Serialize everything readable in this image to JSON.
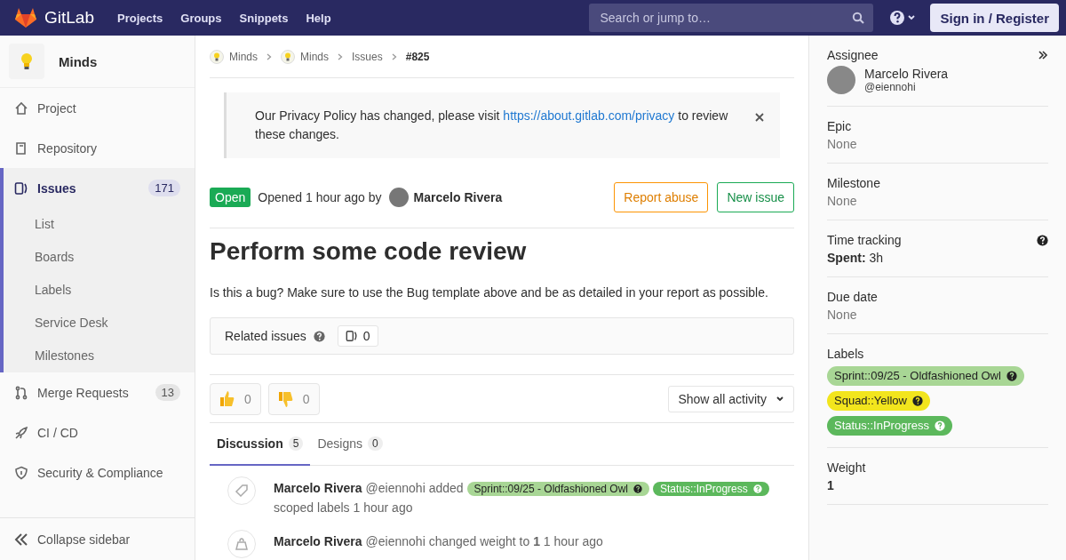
{
  "topbar": {
    "brand": "GitLab",
    "nav": [
      "Projects",
      "Groups",
      "Snippets",
      "Help"
    ],
    "search": {
      "placeholder": "Search or jump to…"
    },
    "sign_in": "Sign in / Register"
  },
  "sidebar": {
    "project": "Minds",
    "items": [
      {
        "label": "Project",
        "kind": "home",
        "selected": false
      },
      {
        "label": "Repository",
        "kind": "book",
        "selected": false
      },
      {
        "label": "Issues",
        "kind": "issues",
        "count": "171",
        "selected": true,
        "children": [
          {
            "label": "List"
          },
          {
            "label": "Boards"
          },
          {
            "label": "Labels"
          },
          {
            "label": "Service Desk"
          },
          {
            "label": "Milestones"
          }
        ]
      },
      {
        "label": "Merge Requests",
        "kind": "merge",
        "count": "13",
        "selected": false
      },
      {
        "label": "CI / CD",
        "kind": "rocket",
        "selected": false
      },
      {
        "label": "Security & Compliance",
        "kind": "shield",
        "selected": false
      }
    ],
    "collapse": "Collapse sidebar"
  },
  "breadcrumbs": [
    {
      "label": "Minds",
      "avatar": true
    },
    {
      "label": "Minds",
      "avatar": true
    },
    {
      "label": "Issues",
      "avatar": false
    },
    {
      "label": "#825",
      "avatar": false
    }
  ],
  "alert": {
    "before": "Our Privacy Policy has changed, please visit",
    "link": "https://about.gitlab.com/privacy",
    "after": "to review these changes."
  },
  "issue": {
    "status": "Open",
    "opened": "Opened 1 hour ago by",
    "author": "Marcelo Rivera",
    "report": "Report abuse",
    "new": "New issue",
    "title": "Perform some code review",
    "description": "Is this a bug? Make sure to use the Bug template above and be as detailed in your report as possible."
  },
  "related": {
    "label": "Related issues",
    "count": "0"
  },
  "reactions": [
    {
      "kind": "thumbsup",
      "count": "0"
    },
    {
      "kind": "thumbsdown",
      "count": "0"
    }
  ],
  "activity_filter": "Show all activity",
  "tabs": [
    {
      "label": "Discussion",
      "count": "5",
      "selected": true
    },
    {
      "label": "Designs",
      "count": "0",
      "selected": false
    }
  ],
  "notes": [
    {
      "kind": "tag",
      "author": "Marcelo Rivera",
      "text": "@eiennohi added",
      "labels": [
        {
          "text": "Sprint::09/25 - Oldfashioned Owl",
          "color": "#a8d695"
        },
        {
          "text": "Status::InProgress",
          "color": "#5cb85c"
        }
      ],
      "after": "scoped labels 1 hour ago"
    },
    {
      "kind": "weight",
      "author": "Marcelo Rivera",
      "text": "@eiennohi changed weight to **1** 1 hour ago"
    }
  ],
  "right": {
    "assignee": {
      "title": "Assignee",
      "name": "Marcelo Rivera",
      "handle": "@eiennohi"
    },
    "blocks": [
      {
        "title": "Epic",
        "value": "None",
        "kind": "none"
      },
      {
        "title": "Milestone",
        "value": "None",
        "kind": "none"
      },
      {
        "title": "Time tracking",
        "kind": "time",
        "help": true,
        "spent_label": "Spent:",
        "value": "3h"
      },
      {
        "title": "Due date",
        "value": "None",
        "kind": "none"
      },
      {
        "title": "Labels",
        "kind": "labels",
        "labels": [
          {
            "text": "Sprint::09/25 - Oldfashioned Owl",
            "color": "#a8d695"
          },
          {
            "text": "Squad::Yellow",
            "color": "#f2e51d"
          },
          {
            "text": "Status::InProgress",
            "color": "#5cb85c"
          }
        ]
      },
      {
        "title": "Weight",
        "value": "1",
        "kind": "strong"
      }
    ]
  }
}
